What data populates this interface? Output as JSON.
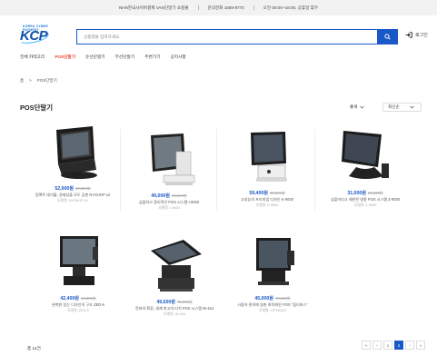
{
  "topbar": {
    "store": "NHN한국사이버결제 VAN단말기 쇼핑몰",
    "phone": "문의전화 1688-9770",
    "hours": "오전 09:00~18:00, 공휴일 휴무"
  },
  "logo": {
    "tagline": "KOREA CYBER PAYMENT",
    "text": "KCP"
  },
  "search": {
    "placeholder": "상품명을 입력하세요."
  },
  "header": {
    "login_label": "로그인"
  },
  "nav": {
    "items": [
      {
        "label": "전체 카테고리"
      },
      {
        "label": "POS단말기"
      },
      {
        "label": "유선단말기"
      },
      {
        "label": "무선단말기"
      },
      {
        "label": "주변기기"
      },
      {
        "label": "공지사항"
      }
    ]
  },
  "breadcrumb": {
    "home": "홈",
    "sep": ">",
    "current": "POS단말기"
  },
  "page": {
    "title": "POS단말기"
  },
  "sort": {
    "order": "좋게",
    "filter": "최신순"
  },
  "products": [
    {
      "price": "52,000원",
      "original": "80,000원",
      "name": "컴팩트 테이블, 경제성을 모두 갖춘 NYSHOP x2",
      "model": "모델명: NYSHOP x2"
    },
    {
      "price": "40,000원",
      "original": "60,000원",
      "name": "심플하고 합리적인 POS 시스템 I-9000",
      "model": "모델명: I-9000"
    },
    {
      "price": "59,400원",
      "original": "90,000원",
      "name": "고성능의 프리미엄 디자인 K-9000",
      "model": "모델명: K-9000"
    },
    {
      "price": "31,000원",
      "original": "50,000원",
      "name": "심플하다고 제한된 영종 POS 시스템 Z-9000",
      "model": "모델명: Z-9000"
    },
    {
      "price": "42,400원",
      "original": "64,000원",
      "name": "완벽한 있는 디자인의 구조 ZED-6",
      "model": "모델명: ZED-5"
    },
    {
      "price": "49,500원",
      "original": "75,000원",
      "name": "전바의 확장, 세계 최고의 터치 POS 시스템 W-154",
      "model": "모델명: W-154"
    },
    {
      "price": "45,000원",
      "original": "70,000원",
      "name": "사용자 편의에 맞춘 최적화된 POS \"옵티머스\"",
      "model": "모델명: OPTIMUS"
    }
  ],
  "footer": {
    "total": "총 14건"
  },
  "pagination": {
    "first": "«",
    "prev": "‹",
    "p1": "1",
    "p2": "2",
    "next": "›",
    "last": "»",
    "current": "2"
  },
  "colors": {
    "accent": "#1a57c7",
    "active_nav": "#e8432b",
    "price": "#1a57c7",
    "topbar_bg": "#f2f2f2"
  }
}
